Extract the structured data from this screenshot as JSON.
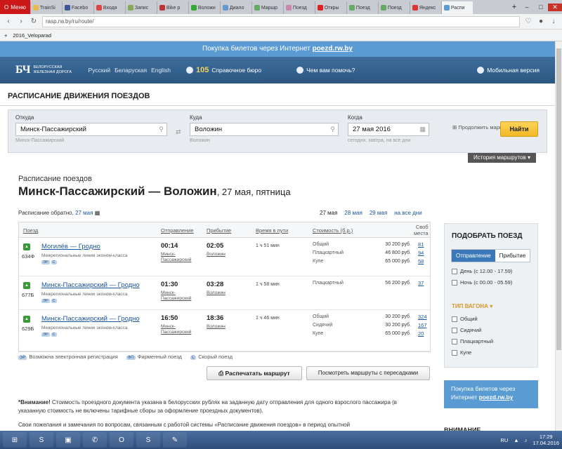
{
  "browser": {
    "menu_label": "Меню",
    "tabs": [
      "TrainSi",
      "Facebo",
      "Входя",
      "Запис",
      "Bike p",
      "Воложи",
      "Диало",
      "Маршр",
      "Поезд",
      "Откры",
      "Поезд",
      "Поезд",
      "Яндекс",
      "Распи"
    ],
    "url": "rasp.rw.by/ru/route/",
    "bookmark": "2016_Veloparad"
  },
  "promo": {
    "text": "Покупка билетов через Интернет ",
    "link": "poezd.rw.by"
  },
  "header": {
    "logo_mark": "БЧ",
    "logo_sub": "БЕЛОРУССКАЯ ЖЕЛЕЗНАЯ ДОРОГА",
    "langs": [
      "Русский",
      "Беларуская",
      "English"
    ],
    "ref_num": "105",
    "ref_label": "Справочное бюро",
    "help": "Чем вам помочь?",
    "mobile": "Мобильная версия"
  },
  "page_title": "РАСПИСАНИЕ ДВИЖЕНИЯ ПОЕЗДОВ",
  "search": {
    "from_label": "Откуда",
    "from_value": "Минск-Пассажирский",
    "from_hint": "Минск-Пассажирский",
    "to_label": "Куда",
    "to_value": "Воложин",
    "to_hint": "Воложин",
    "when_label": "Когда",
    "when_value": "27 мая 2016",
    "when_hint": "сегодня, завтра, на все дни",
    "continue": "Продолжить маршрут",
    "find": "Найти",
    "history": "История маршрутов"
  },
  "schedule": {
    "label": "Расписание поездов",
    "route": "Минск-Пассажирский — Воложин",
    "date": ", 27 мая, пятница",
    "back_label": "Расписание обратно, ",
    "back_date": "27 мая",
    "dates": [
      "27 мая",
      "28 мая",
      "29 мая",
      "на все дни"
    ]
  },
  "table": {
    "headers": {
      "train": "Поезд",
      "dep": "Отправление",
      "arr": "Прибытие",
      "dur": "Время в пути",
      "cost": "Стоимость (б.р.)",
      "seats1": "Своб",
      "seats2": "места"
    },
    "rows": [
      {
        "num": "634Ф",
        "name": "Могилёв — Гродно",
        "type": "Межрегиональные линии эконом-класса",
        "dep": "00:14",
        "dep_st": "Минск-Пассажирский",
        "arr": "02:05",
        "arr_st": "Воложин",
        "dur": "1 ч 51 мин",
        "classes": [
          "Общий",
          "Плацкартный",
          "Купе"
        ],
        "prices": [
          "30 200 руб.",
          "46 800 руб.",
          "65 000 руб."
        ],
        "seats": [
          "81",
          "94",
          "58"
        ]
      },
      {
        "num": "677Б",
        "name": "Минск-Пассажирский — Гродно",
        "type": "Межрегиональные линии эконом-класса",
        "dep": "01:30",
        "dep_st": "Минск-Пассажирский",
        "arr": "03:28",
        "arr_st": "Воложин",
        "dur": "1 ч 58 мин",
        "classes": [
          "Плацкартный"
        ],
        "prices": [
          "56 200 руб."
        ],
        "seats": [
          "37"
        ]
      },
      {
        "num": "629Б",
        "name": "Минск-Пассажирский — Гродно",
        "type": "Межрегиональные линии эконом-класса",
        "dep": "16:50",
        "dep_st": "Минск-Пассажирский",
        "arr": "18:36",
        "arr_st": "Воложин",
        "dur": "1 ч 46 мин",
        "classes": [
          "Общий",
          "Сидячий",
          "Купе"
        ],
        "prices": [
          "30 200 руб.",
          "30 200 руб.",
          "65 000 руб."
        ],
        "seats": [
          "324",
          "167",
          "20"
        ]
      }
    ]
  },
  "legend": {
    "er": "Возможна электронная регистрация",
    "fp": "Фирменный поезд",
    "fast": "Скорый поезд"
  },
  "buttons": {
    "print": "Распечатать маршрут",
    "transfers": "Посмотреть маршруты с пересадками"
  },
  "note": {
    "bold": "*Внимание!",
    "text": " Стоимость проездного документа указана в белорусских рублях на заданную дату отправления для одного взрослого пассажира (в указанную стоимость не включены тарифные сборы за оформление проездных документов).",
    "text2": "Свои пожелания и замечания по вопросам, связанным с работой системы «Расписание движения поездов» в период опытной"
  },
  "filter": {
    "title": "ПОДОБРАТЬ ПОЕЗД",
    "seg": [
      "Отправление",
      "Прибытие"
    ],
    "times": [
      "День (с 12.00 - 17.59)",
      "Ночь (с 00.00 - 05.59)"
    ],
    "wagon_title": "ТИП ВАГОНА",
    "wagons": [
      "Общий",
      "Сидячий",
      "Плацкартный",
      "Купе"
    ]
  },
  "buybox": {
    "text": "Покупка билетов через Интернет ",
    "link": "poezd.rw.by"
  },
  "attention": "ВНИМАНИЕ",
  "taskbar": {
    "lang": "RU",
    "time": "17:29",
    "date": "17.04.2016"
  }
}
